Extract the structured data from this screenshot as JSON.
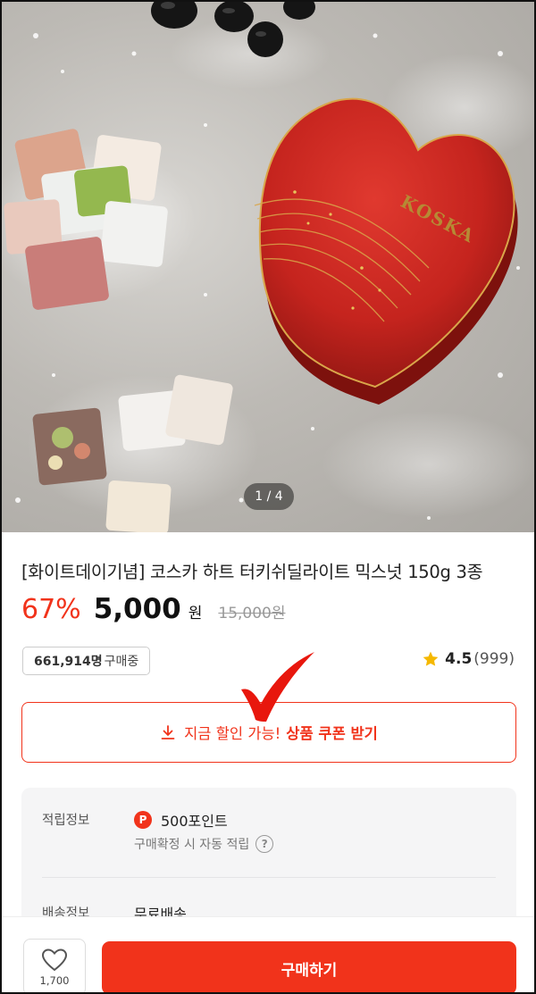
{
  "gallery": {
    "page_indicator": "1 / 4",
    "brand_text": "KOSKA"
  },
  "product": {
    "title": "[화이트데이기념] 코스카 하트 터키쉬딜라이트 믹스넛 150g 3종",
    "discount": "67%",
    "price": "5,000",
    "currency": "원",
    "original_price": "15,000원",
    "buyers_count": "661,914명",
    "buyers_suffix": "구매중",
    "rating": "4.5",
    "review_count": "(999)"
  },
  "coupon": {
    "normal_text": "지금 할인 가능!",
    "strong_text": "상품 쿠폰 받기",
    "icon": "download-icon"
  },
  "info": {
    "points_label": "적립정보",
    "points_badge": "P",
    "points_value": "500포인트",
    "points_note": "구매확정 시 자동 적립",
    "help_symbol": "?",
    "shipping_label": "배송정보",
    "shipping_value": "무료배송"
  },
  "bottom_bar": {
    "like_count": "1,700",
    "buy_label": "구매하기"
  },
  "colors": {
    "accent": "#f1331b",
    "star": "#f5b800",
    "tin_red": "#c5241e"
  }
}
